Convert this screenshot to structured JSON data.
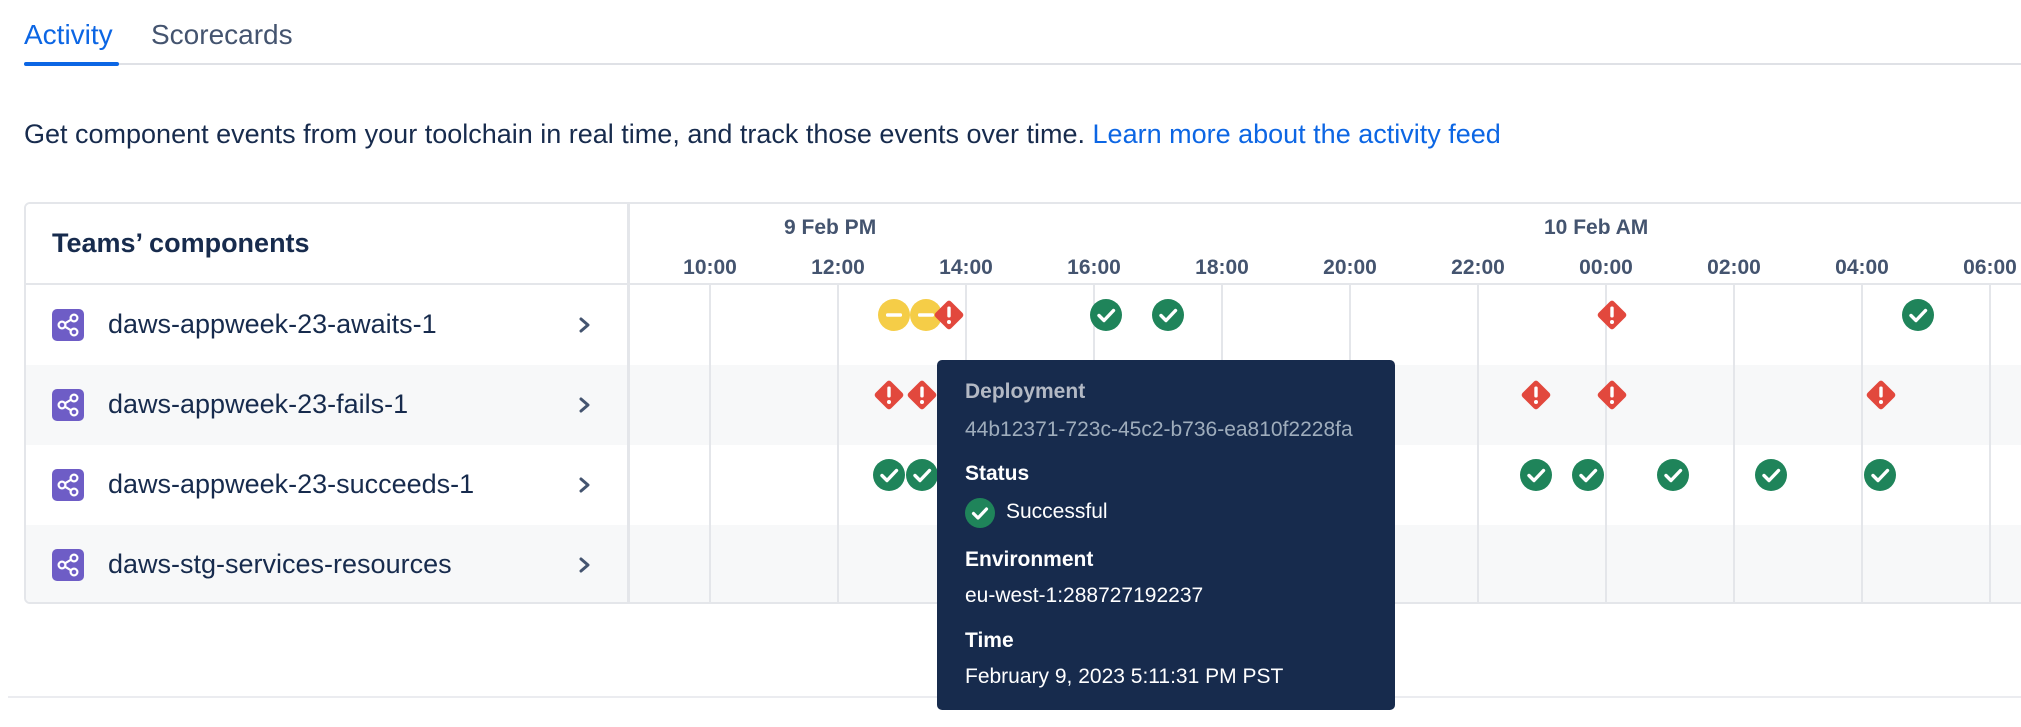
{
  "tabs": [
    {
      "label": "Activity",
      "active": true
    },
    {
      "label": "Scorecards",
      "active": false
    }
  ],
  "description": {
    "text": "Get component events from your toolchain in real time, and track those events over time. ",
    "link": "Learn more about the activity feed"
  },
  "components": {
    "header": "Teams’ components",
    "items": [
      {
        "name": "daws-appweek-23-awaits-1"
      },
      {
        "name": "daws-appweek-23-fails-1"
      },
      {
        "name": "daws-appweek-23-succeeds-1"
      },
      {
        "name": "daws-stg-services-resources"
      }
    ]
  },
  "timeline": {
    "dates": [
      "9 Feb PM",
      "10 Feb AM"
    ],
    "hours": [
      "10:00",
      "12:00",
      "14:00",
      "16:00",
      "18:00",
      "20:00",
      "22:00",
      "00:00",
      "02:00",
      "04:00",
      "06:00"
    ]
  },
  "events": [
    {
      "row": 0,
      "hour": 12.87,
      "status": "in-progress"
    },
    {
      "row": 0,
      "hour": 13.37,
      "status": "in-progress"
    },
    {
      "row": 0,
      "hour": 13.73,
      "status": "failed"
    },
    {
      "row": 0,
      "hour": 16.18,
      "status": "successful"
    },
    {
      "row": 0,
      "hour": 17.15,
      "status": "successful"
    },
    {
      "row": 0,
      "hour": 24.1,
      "status": "failed"
    },
    {
      "row": 0,
      "hour": 28.87,
      "status": "successful"
    },
    {
      "row": 1,
      "hour": 12.8,
      "status": "failed"
    },
    {
      "row": 1,
      "hour": 13.32,
      "status": "failed"
    },
    {
      "row": 1,
      "hour": 22.9,
      "status": "failed"
    },
    {
      "row": 1,
      "hour": 24.1,
      "status": "failed"
    },
    {
      "row": 1,
      "hour": 28.3,
      "status": "failed"
    },
    {
      "row": 2,
      "hour": 12.8,
      "status": "successful"
    },
    {
      "row": 2,
      "hour": 13.32,
      "status": "successful"
    },
    {
      "row": 2,
      "hour": 22.9,
      "status": "successful"
    },
    {
      "row": 2,
      "hour": 23.72,
      "status": "successful"
    },
    {
      "row": 2,
      "hour": 25.05,
      "status": "successful"
    },
    {
      "row": 2,
      "hour": 26.58,
      "status": "successful"
    },
    {
      "row": 2,
      "hour": 28.28,
      "status": "successful"
    }
  ],
  "tooltip": {
    "title": "Deployment",
    "id": "44b12371-723c-45c2-b736-ea810f2228fa",
    "status_label": "Status",
    "status_value": "Successful",
    "environment_label": "Environment",
    "environment_value": "eu-west-1:288727192237",
    "time_label": "Time",
    "time_value": "February 9, 2023 5:11:31 PM PST"
  },
  "colors": {
    "accent": "#0c66e4",
    "success": "#1f845a",
    "failed": "#e2483d",
    "in_progress": "#f5cd47",
    "component_icon": "#6e5dc6",
    "tooltip_bg": "#172b4d"
  }
}
